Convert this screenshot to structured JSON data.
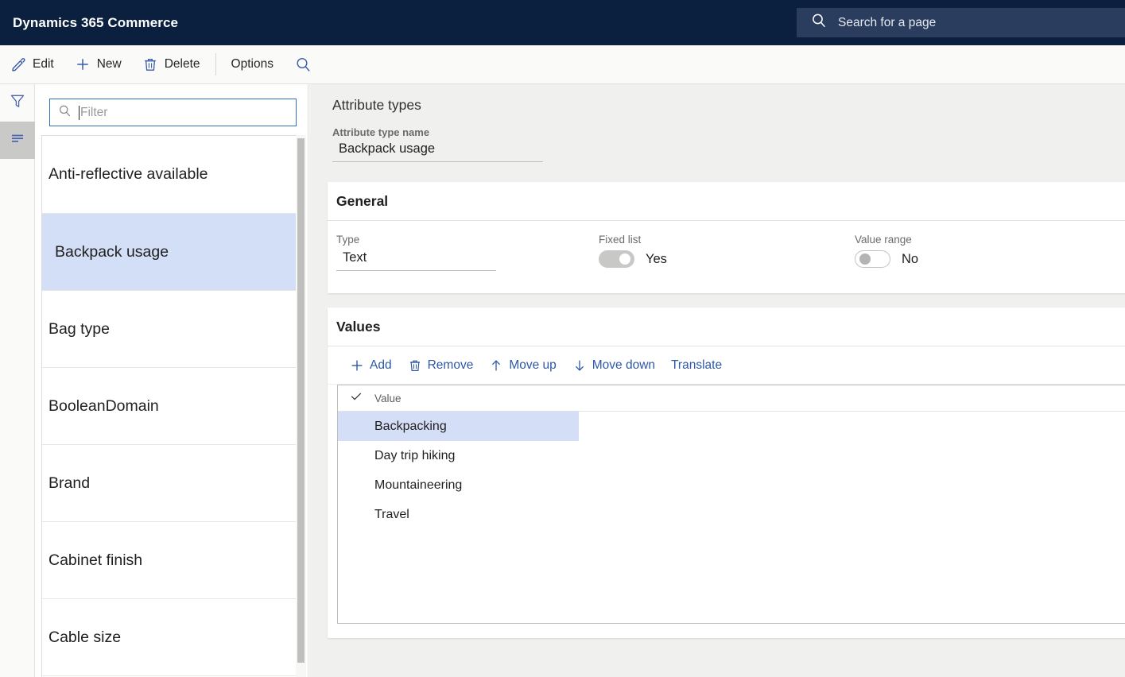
{
  "topbar": {
    "app_title": "Dynamics 365 Commerce",
    "search_placeholder": "Search for a page",
    "search_icon": "search-icon",
    "background_color": "#0b1f3f",
    "search_background_color": "#2b3d5e"
  },
  "actionbar": {
    "buttons": [
      {
        "label": "Edit",
        "icon": "pencil-icon"
      },
      {
        "label": "New",
        "icon": "plus-icon"
      },
      {
        "label": "Delete",
        "icon": "trash-icon"
      },
      {
        "label": "Options",
        "icon": "none"
      }
    ],
    "search_icon": "search-icon",
    "icon_color": "#3b5ba9"
  },
  "rail": {
    "items": [
      {
        "name": "filter-pane-icon",
        "icon": "funnel-icon",
        "selected": false
      },
      {
        "name": "list-pane-icon",
        "icon": "lines-icon",
        "selected": true
      }
    ]
  },
  "list_pane": {
    "filter": {
      "placeholder": "Filter",
      "value": "",
      "icon": "search-icon",
      "focused": true
    },
    "items": [
      {
        "label": "Anti-reflective available",
        "selected": false
      },
      {
        "label": "Backpack usage",
        "selected": true
      },
      {
        "label": "Bag type",
        "selected": false
      },
      {
        "label": "BooleanDomain",
        "selected": false
      },
      {
        "label": "Brand",
        "selected": false
      },
      {
        "label": "Cabinet finish",
        "selected": false
      },
      {
        "label": "Cable size",
        "selected": false
      }
    ],
    "selected_color": "#d3deF7",
    "scrollbar": {
      "visible": true
    }
  },
  "content": {
    "page_title": "Attribute types",
    "attribute_type_name": {
      "label": "Attribute type name",
      "value": "Backpack usage"
    },
    "general": {
      "title": "General",
      "type": {
        "label": "Type",
        "value": "Text"
      },
      "fixed_list": {
        "label": "Fixed list",
        "state": "Yes",
        "on": true
      },
      "value_range": {
        "label": "Value range",
        "state": "No",
        "on": false
      }
    },
    "values": {
      "title": "Values",
      "toolbar": [
        {
          "label": "Add",
          "icon": "plus-icon"
        },
        {
          "label": "Remove",
          "icon": "trash-icon"
        },
        {
          "label": "Move up",
          "icon": "arrow-up-icon"
        },
        {
          "label": "Move down",
          "icon": "arrow-down-icon"
        },
        {
          "label": "Translate",
          "icon": "none"
        }
      ],
      "grid": {
        "header_check_icon": "checkmark-icon",
        "column_header": "Value",
        "rows": [
          {
            "value": "Backpacking",
            "selected": true
          },
          {
            "value": "Day trip hiking",
            "selected": false
          },
          {
            "value": "Mountaineering",
            "selected": false
          },
          {
            "value": "Travel",
            "selected": false
          }
        ],
        "selected_color": "#d4deF7"
      }
    }
  }
}
